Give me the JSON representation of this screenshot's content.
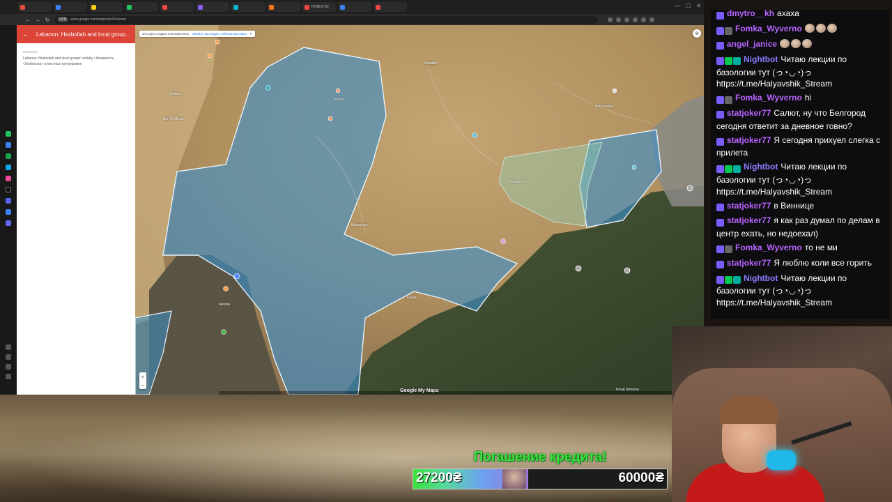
{
  "browser": {
    "tabs": [
      {
        "label": "",
        "color": "#e74c3c"
      },
      {
        "label": "",
        "color": "#3b82f6"
      },
      {
        "label": "",
        "color": "#facc15"
      },
      {
        "label": "",
        "color": "#22c55e"
      },
      {
        "label": "",
        "color": "#ef4444"
      },
      {
        "label": "",
        "color": "#8b5cf6"
      },
      {
        "label": "",
        "color": "#06b6d4"
      },
      {
        "label": "",
        "color": "#f97316"
      },
      {
        "label": "НОВОСТИ",
        "color": "#ef4444"
      },
      {
        "label": "",
        "color": "#3b82f6"
      },
      {
        "label": "",
        "color": "#ef4444"
      }
    ],
    "vpn_label": "VPN",
    "url": "www.google.com/maps/d/u/0/viewer"
  },
  "left_panel": {
    "title": "Lebanon: Hezbollah and local group...",
    "small_label": "Изменено",
    "description": "Lebanon: Hezbollah and local groups' activity / Активность «Хезболлы» и местных группировок"
  },
  "map": {
    "notice_text": "Эта карта создана пользователем.",
    "notice_link": "Узнайте, как создать собственную карту",
    "zoom_in": "+",
    "zoom_out": "−",
    "attribution": "Google My Maps",
    "place_labels": [
      {
        "name": "Khraibeh"
      },
      {
        "name": "Marjayoun"
      },
      {
        "name": "Hasbaya"
      },
      {
        "name": "Metulla"
      },
      {
        "name": "Kiryat Shmona"
      },
      {
        "name": "Ghajar"
      },
      {
        "name": "Kfarchouba"
      },
      {
        "name": "Borj El Mlouk"
      },
      {
        "name": "Dibbine"
      },
      {
        "name": "Khiam"
      }
    ]
  },
  "chat": {
    "messages": [
      {
        "user": "Fomka_Wyverno",
        "user_color": "#b964ff",
        "badges": [
          "#7b5cff"
        ],
        "text": "ахаха",
        "emotes": 0
      },
      {
        "user": "dmytro__kh",
        "user_color": "#b964ff",
        "badges": [
          "#7b5cff"
        ],
        "text": "ахаха",
        "emotes": 0
      },
      {
        "user": "Fomka_Wyverno",
        "user_color": "#b964ff",
        "badges": [
          "#7b5cff",
          "#666666"
        ],
        "text": "",
        "emotes": 3
      },
      {
        "user": "angel_janice",
        "user_color": "#b964ff",
        "badges": [
          "#7b5cff"
        ],
        "text": "",
        "emotes": 3
      },
      {
        "user": "Nightbot",
        "user_color": "#8a7dff",
        "badges": [
          "#7b5cff",
          "#00c853",
          "#00ad9f"
        ],
        "text": "Читаю лекции по базологии тут (っ◔◡◔)っ https://t.me/Halyavshik_Stream",
        "emotes": 0
      },
      {
        "user": "Fomka_Wyverno",
        "user_color": "#b964ff",
        "badges": [
          "#7b5cff",
          "#666666"
        ],
        "text": "hi",
        "emotes": 0
      },
      {
        "user": "statjoker77",
        "user_color": "#b964ff",
        "badges": [
          "#7b5cff"
        ],
        "text": "Салют, ну что Белгород сегодня ответит за дневное говно?",
        "emotes": 0
      },
      {
        "user": "statjoker77",
        "user_color": "#b964ff",
        "badges": [
          "#7b5cff"
        ],
        "text": "Я сегодня прихуел слегка с прилета",
        "emotes": 0
      },
      {
        "user": "Nightbot",
        "user_color": "#8a7dff",
        "badges": [
          "#7b5cff",
          "#00c853",
          "#00ad9f"
        ],
        "text": "Читаю лекции по базологии тут (っ◔◡◔)っ https://t.me/Halyavshik_Stream",
        "emotes": 0
      },
      {
        "user": "statjoker77",
        "user_color": "#b964ff",
        "badges": [
          "#7b5cff"
        ],
        "text": "в Виннице",
        "emotes": 0
      },
      {
        "user": "statjoker77",
        "user_color": "#b964ff",
        "badges": [
          "#7b5cff"
        ],
        "text": "я как раз думал по делам в центр ехать, но недоехал)",
        "emotes": 0
      },
      {
        "user": "Fomka_Wyverno",
        "user_color": "#b964ff",
        "badges": [
          "#7b5cff",
          "#666666"
        ],
        "text": "то не ми",
        "emotes": 0
      },
      {
        "user": "statjoker77",
        "user_color": "#b964ff",
        "badges": [
          "#7b5cff"
        ],
        "text": "Я люблю коли все горить",
        "emotes": 0
      },
      {
        "user": "Nightbot",
        "user_color": "#8a7dff",
        "badges": [
          "#7b5cff",
          "#00c853",
          "#00ad9f"
        ],
        "text": "Читаю лекции по базологии тут (っ◔◡◔)っ https://t.me/Halyavshik_Stream",
        "emotes": 0
      }
    ]
  },
  "donation_goal": {
    "title": "Погашение кредита!",
    "current": "27200₴",
    "target": "60000₴",
    "progress_fraction": 0.453
  }
}
